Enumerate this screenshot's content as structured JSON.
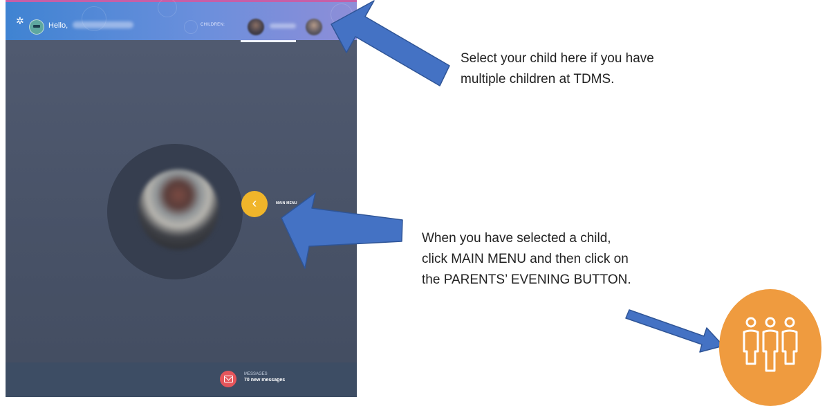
{
  "app": {
    "greeting": "Hello,",
    "children_label": "CHILDREN:",
    "main_menu_label": "MAIN MENU",
    "messages": {
      "label": "MESSAGES",
      "count_text": "70 new messages"
    },
    "colors": {
      "accent_yellow": "#f0b52a",
      "message_red": "#e5555b",
      "header_blue": "#3f83d2",
      "background": "#4a5469"
    }
  },
  "annotations": {
    "note1": [
      "Select your child here if you have",
      "multiple children at TDMS."
    ],
    "note2": [
      "When you have selected a child,",
      "click MAIN MENU and then click on",
      "the PARENTS’ EVENING BUTTON."
    ],
    "arrow_color": "#4472c4",
    "parents_evening_tile": {
      "icon": "three-people-icon",
      "color": "#ef9b3f"
    }
  }
}
